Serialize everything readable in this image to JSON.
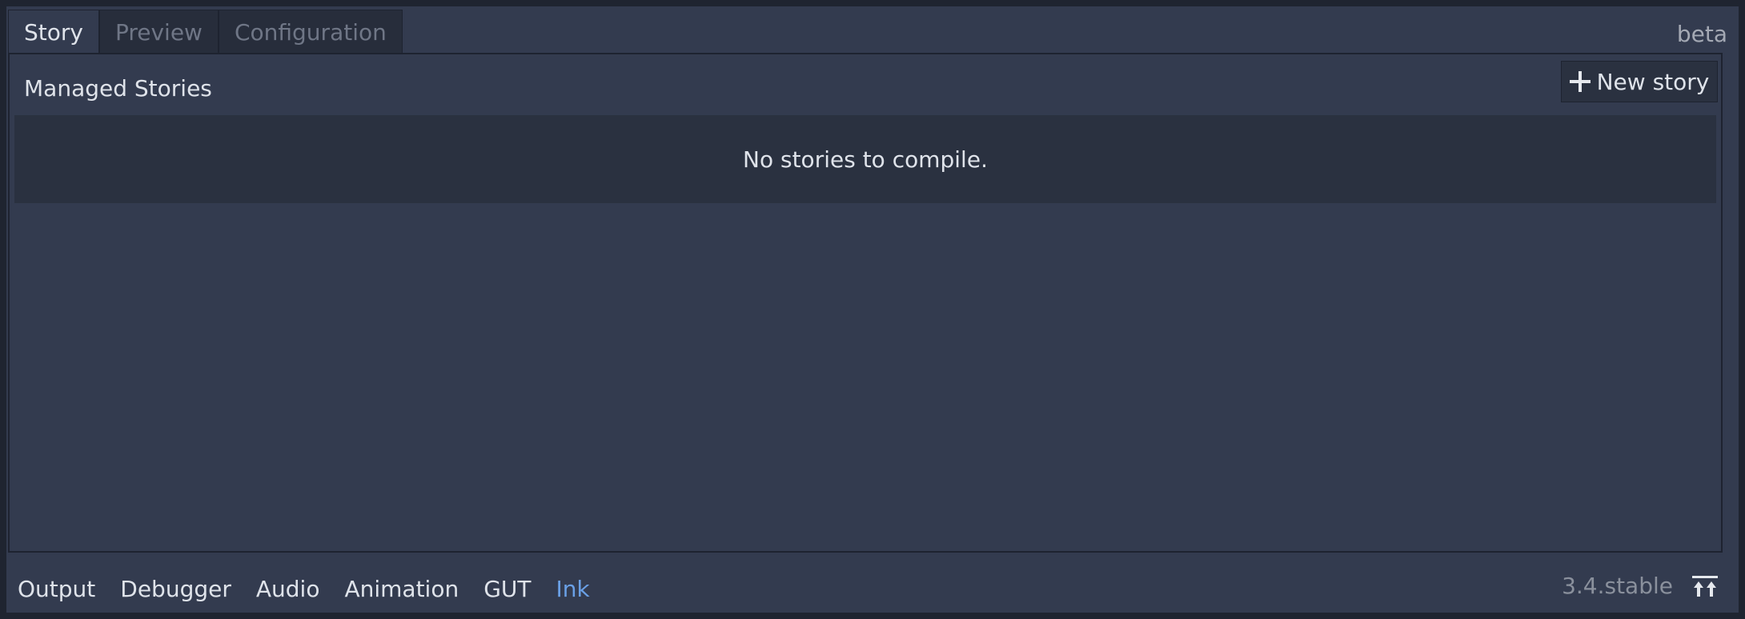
{
  "top_tabs": {
    "story": "Story",
    "preview": "Preview",
    "configuration": "Configuration"
  },
  "version_badge": "beta",
  "panel": {
    "title": "Managed Stories",
    "new_story_label": "New story",
    "empty_message": "No stories to compile."
  },
  "bottom_tabs": {
    "output": "Output",
    "debugger": "Debugger",
    "audio": "Audio",
    "animation": "Animation",
    "gut": "GUT",
    "ink": "Ink"
  },
  "engine_version": "3.4.stable",
  "icons": {
    "new_story": "plus-icon",
    "expand_panel": "expand-bottom-panel-icon"
  },
  "colors": {
    "background": "#333b4f",
    "active_bottom_tab": "#6aa0e6"
  }
}
